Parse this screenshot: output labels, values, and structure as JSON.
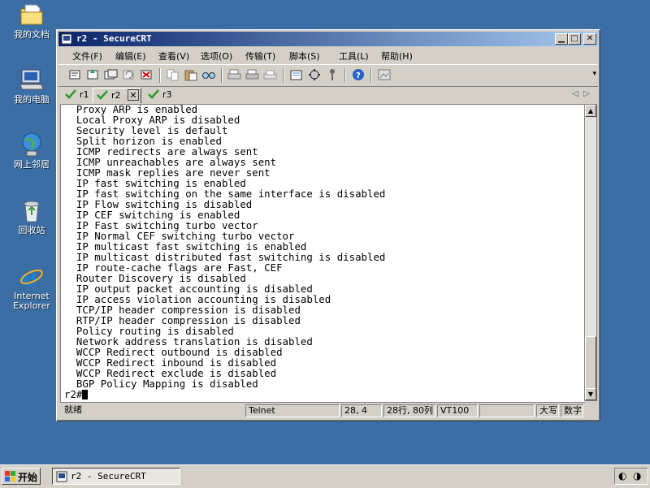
{
  "desktop": {
    "icons": [
      {
        "label": "我的文档"
      },
      {
        "label": "我的电脑"
      },
      {
        "label": "网上邻居"
      },
      {
        "label": "回收站"
      },
      {
        "label": "Internet Explorer"
      }
    ]
  },
  "window": {
    "title": "r2 - SecureCRT",
    "menu": [
      "文件(F)",
      "编辑(E)",
      "查看(V)",
      "选项(O)",
      "传输(T)",
      "脚本(S)",
      "工具(L)",
      "帮助(H)"
    ],
    "tabs": [
      {
        "label": "r1"
      },
      {
        "label": "r2"
      },
      {
        "label": "r3"
      }
    ],
    "terminal_lines": [
      "Proxy ARP is enabled",
      "Local Proxy ARP is disabled",
      "Security level is default",
      "Split horizon is enabled",
      "ICMP redirects are always sent",
      "ICMP unreachables are always sent",
      "ICMP mask replies are never sent",
      "IP fast switching is enabled",
      "IP fast switching on the same interface is disabled",
      "IP Flow switching is disabled",
      "IP CEF switching is enabled",
      "IP Fast switching turbo vector",
      "IP Normal CEF switching turbo vector",
      "IP multicast fast switching is enabled",
      "IP multicast distributed fast switching is disabled",
      "IP route-cache flags are Fast, CEF",
      "Router Discovery is disabled",
      "IP output packet accounting is disabled",
      "IP access violation accounting is disabled",
      "TCP/IP header compression is disabled",
      "RTP/IP header compression is disabled",
      "Policy routing is disabled",
      "Network address translation is disabled",
      "WCCP Redirect outbound is disabled",
      "WCCP Redirect inbound is disabled",
      "WCCP Redirect exclude is disabled",
      "BGP Policy Mapping is disabled"
    ],
    "prompt": "r2#",
    "status": {
      "ready": "就绪",
      "protocol": "Telnet",
      "cursor_pos": "28,  4",
      "size": "28行, 80列",
      "terminal": "VT100",
      "caps": "大写",
      "num": "数字"
    }
  },
  "taskbar": {
    "start_label": "开始",
    "task_label": "r2 - SecureCRT"
  }
}
